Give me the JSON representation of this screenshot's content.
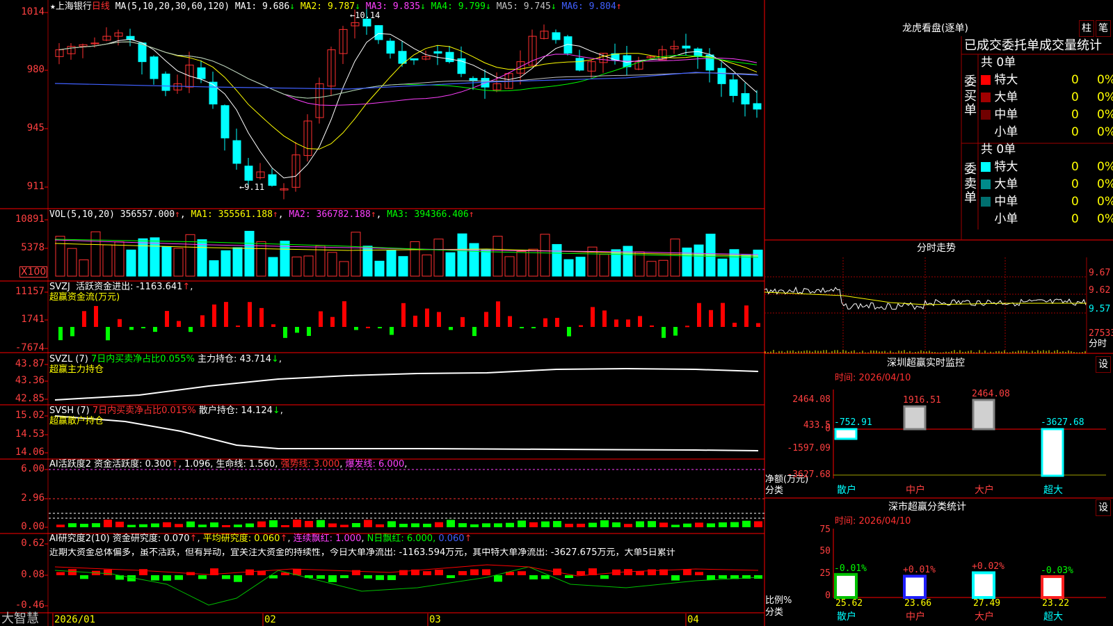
{
  "stock": {
    "name": "上海银行",
    "period": "日线",
    "star": "★"
  },
  "price_panel": {
    "ma_label": "MA(5,10,20,30,60,120)",
    "ma": [
      {
        "label": "MA1:",
        "value": "9.686",
        "arrow": "↓",
        "color": "#ffffff"
      },
      {
        "label": "MA2:",
        "value": "9.787",
        "arrow": "↓",
        "color": "#ffff00"
      },
      {
        "label": "MA3:",
        "value": "9.835",
        "arrow": "↓",
        "color": "#ff40ff"
      },
      {
        "label": "MA4:",
        "value": "9.799",
        "arrow": "↓",
        "color": "#00ff00"
      },
      {
        "label": "MA5:",
        "value": "9.745",
        "arrow": "↓",
        "color": "#c0c0c0"
      },
      {
        "label": "MA6:",
        "value": "9.804",
        "arrow": "↑",
        "color": "#4060ff"
      }
    ],
    "yticks": [
      "1014",
      "980",
      "945",
      "911"
    ],
    "high_note": "←10.14",
    "low_note": "←9.11"
  },
  "vol_panel": {
    "label": "VOL(5,10,20)",
    "value": "356557.000",
    "ma1": "MA1: 355561.188",
    "ma2": "MA2: 366782.188",
    "ma3": "MA3: 394366.406",
    "yticks": [
      "10891",
      "5378"
    ],
    "unit": "X100"
  },
  "svzj_panel": {
    "name": "SVZJ",
    "label": "活跃资金进出: -1163.641",
    "sub": "超赢资金流(万元)",
    "yticks": [
      "11157",
      "1741",
      "-7674"
    ]
  },
  "svzl_panel": {
    "name": "SVZL (7)",
    "ratio": "7日内买卖净占比0.055%",
    "hold": "主力持仓: 43.714",
    "sub": "超赢主力持仓",
    "yticks": [
      "43.87",
      "43.36",
      "42.85"
    ]
  },
  "svsh_panel": {
    "name": "SVSH (7)",
    "ratio": "7日内买卖净占比0.015%",
    "hold": "散户持仓: 14.124",
    "sub": "超赢散户持仓",
    "yticks": [
      "15.02",
      "14.53",
      "14.06"
    ]
  },
  "ai_act_panel": {
    "label": "AI活跃度2 资金活跃度: 0.300",
    "v2": "1.096",
    "life": "生命线: 1.560",
    "strong": "强势线: 3.000",
    "burst": "爆发线: 6.000",
    "yticks": [
      "6.00",
      "2.96",
      "0.00"
    ]
  },
  "ai_res_panel": {
    "label": "AI研究度2(10) 资金研究度: 0.070",
    "avg": "平均研究度: 0.060",
    "red": "连续飘红: 1.000",
    "nday": "N日飘红: 6.000,",
    "last": "0.060",
    "comment": "近期大资金总体偏多，虽不活跃，但有异动，宜关注大资金的持续性，今日大单净流出: -1163.594万元，其中特大单净流出: -3627.675万元，大单5日累计",
    "yticks": [
      "0.62",
      "0.08",
      "-0.46"
    ]
  },
  "xaxis": {
    "labels": [
      "2026/01",
      "02",
      "03",
      "04"
    ]
  },
  "brand": "大智慧",
  "right": {
    "lhkp_title": "龙虎看盘(逐单)",
    "btn_bar": "柱",
    "btn_pen": "笔",
    "lhkp_header": "已成交委托单成交量统计",
    "buy": {
      "side": "委买单",
      "total": "共 0单",
      "rows": [
        {
          "name": "特大",
          "v": "0",
          "p": "0%",
          "color": "#ff0000"
        },
        {
          "name": "大单",
          "v": "0",
          "p": "0%",
          "color": "#a00000"
        },
        {
          "name": "中单",
          "v": "0",
          "p": "0%",
          "color": "#700000"
        },
        {
          "name": "小单",
          "v": "0",
          "p": "0%",
          "color": "#000000"
        }
      ]
    },
    "sell": {
      "side": "委卖单",
      "total": "共 0单",
      "rows": [
        {
          "name": "特大",
          "v": "0",
          "p": "0%",
          "color": "#00ffff"
        },
        {
          "name": "大单",
          "v": "0",
          "p": "0%",
          "color": "#008b8b"
        },
        {
          "name": "中单",
          "v": "0",
          "p": "0%",
          "color": "#006f6f"
        },
        {
          "name": "小单",
          "v": "0",
          "p": "0%",
          "color": "#000000"
        }
      ]
    },
    "fsz_title": "分时走势",
    "fsz_y": [
      "9.67",
      "9.62",
      "9.57",
      "27533",
      "分时"
    ],
    "sz_title": "深圳超赢实时监控",
    "sz_time": "时间: 2026/04/10",
    "sz_y": [
      "2464.08",
      "433.5",
      "0",
      "-1597.09",
      "-3627.68"
    ],
    "sz_footer": [
      "净额(万元)",
      "分类"
    ],
    "sz_set": "设",
    "sc_title": "深市超赢分类统计",
    "sc_time": "时间: 2026/04/10",
    "sc_y": [
      "75",
      "50",
      "25",
      "0"
    ],
    "sc_footer": [
      "比例%",
      "分类"
    ],
    "sc_set": "设"
  },
  "chart_data": [
    {
      "type": "bar",
      "title": "深圳超赢实时监控",
      "ylabel": "净额(万元)",
      "categories": [
        "散户",
        "中户",
        "大户",
        "超大"
      ],
      "values": [
        -752.91,
        1916.51,
        2464.08,
        -3627.68
      ],
      "ylim": [
        -3627.68,
        2464.08
      ]
    },
    {
      "type": "bar",
      "title": "深市超赢分类统计",
      "ylabel": "比例%",
      "categories": [
        "散户",
        "中户",
        "大户",
        "超大"
      ],
      "values": [
        25.62,
        23.66,
        27.49,
        23.22
      ],
      "changes": [
        "-0.01%",
        "+0.01%",
        "+0.02%",
        "-0.03%"
      ],
      "colors": [
        "#00c000",
        "#2020ff",
        "#00ffff",
        "#ff2020"
      ],
      "ylim": [
        0,
        75
      ]
    }
  ]
}
